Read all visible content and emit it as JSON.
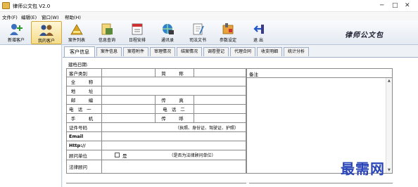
{
  "window": {
    "title": "律师公文包 V2.0"
  },
  "menu": {
    "items": [
      "文件(F)",
      "编辑(E)",
      "窗口(W)",
      "帮助(H)"
    ]
  },
  "toolbar": {
    "buttons": [
      {
        "label": "新增客户",
        "icon": "add-client-icon"
      },
      {
        "label": "我的客户",
        "icon": "clients-icon"
      },
      {
        "label": "案件列表",
        "icon": "case-list-icon"
      },
      {
        "label": "信息查询",
        "icon": "search-info-icon"
      },
      {
        "label": "日程安排",
        "icon": "schedule-icon"
      },
      {
        "label": "通讯录",
        "icon": "address-book-icon"
      },
      {
        "label": "司法文书",
        "icon": "legal-document-icon"
      },
      {
        "label": "参数设定",
        "icon": "settings-icon"
      },
      {
        "label": "退 出",
        "icon": "exit-icon"
      }
    ],
    "brand": "律师公文包"
  },
  "tabs": [
    "客户信息",
    "案件信息",
    "案卷附件",
    "审理情况",
    "结案情况",
    "调卷登记",
    "代理合同",
    "收支明细",
    "统计分析"
  ],
  "form": {
    "date_label": "建档日期:",
    "rows": {
      "client_type": "客户类别",
      "abbr": "简　称",
      "full_name": "全　称",
      "address": "地　址",
      "postcode": "邮　编",
      "fax": "传　真",
      "phone1": "电 话 一",
      "phone2": "电 话 二",
      "mobile": "手　机",
      "pager": "传　呼",
      "id_number": "证件号码",
      "id_note": "（执照、身份证、驾驶证、护照）",
      "email": "Email",
      "http": "Http://",
      "advisor": "顾问单位",
      "advisor_check": "是",
      "advisor_note": "（是否为法律顾问单位）",
      "legal_advisor": "法律顾问"
    }
  },
  "memo": {
    "label": "备注"
  },
  "watermark": "最需网"
}
